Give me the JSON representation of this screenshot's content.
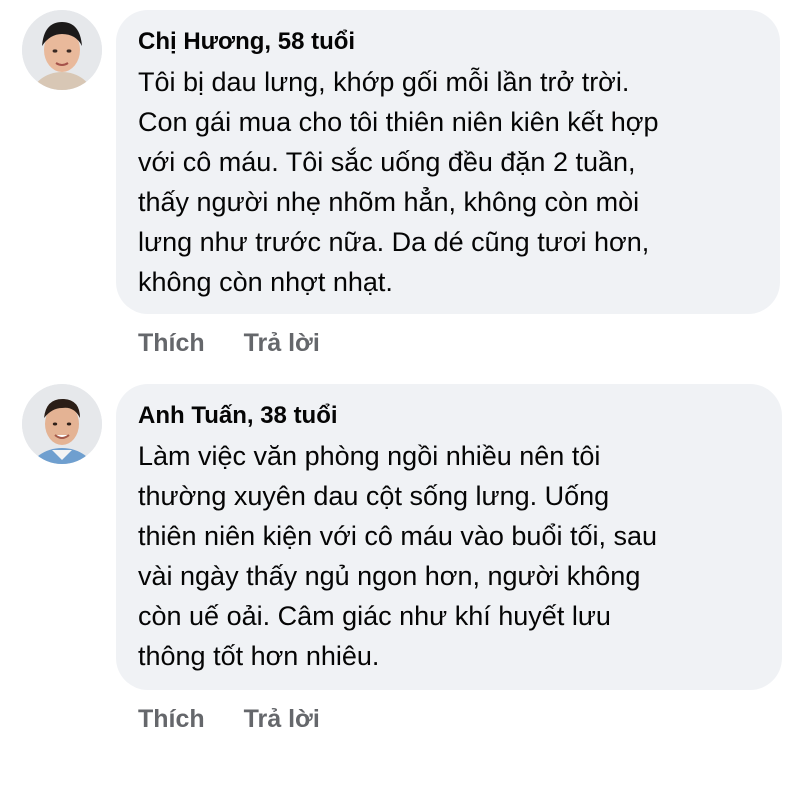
{
  "comments": [
    {
      "author": "Chị Hương, 58 tuổi",
      "lines": [
        "Tôi bị dau lưng, khớp gối mỗi lần trở trời.",
        "Con gái mua cho tôi thiên niên kiên kết hợp",
        "với cô máu. Tôi sắc uống đều đặn 2 tuần,",
        "thấy người nhẹ nhõm hẳn, không còn mòi",
        "lưng như trước nữa. Da dé cũng tươi hơn,",
        "không còn nhợt nhạt."
      ],
      "like_label": "Thích",
      "reply_label": "Trả lời",
      "avatar_icon": "woman-avatar-icon"
    },
    {
      "author": "Anh Tuấn, 38 tuổi",
      "lines": [
        "Làm việc văn phòng ngồi nhiều nên tôi",
        "thường xuyên dau cột sống lưng. Uống",
        "thiên niên kiện với cô máu vào buổi tối, sau",
        "vài ngày thấy ngủ ngon hơn, người không",
        "còn uế oải. Câm giác như khí huyết lưu",
        "thông tốt hơn nhiêu."
      ],
      "like_label": "Thích",
      "reply_label": "Trả lời",
      "avatar_icon": "man-avatar-icon"
    }
  ],
  "colors": {
    "bubble": "#f0f2f5",
    "text": "#050505",
    "action": "#65676b"
  }
}
